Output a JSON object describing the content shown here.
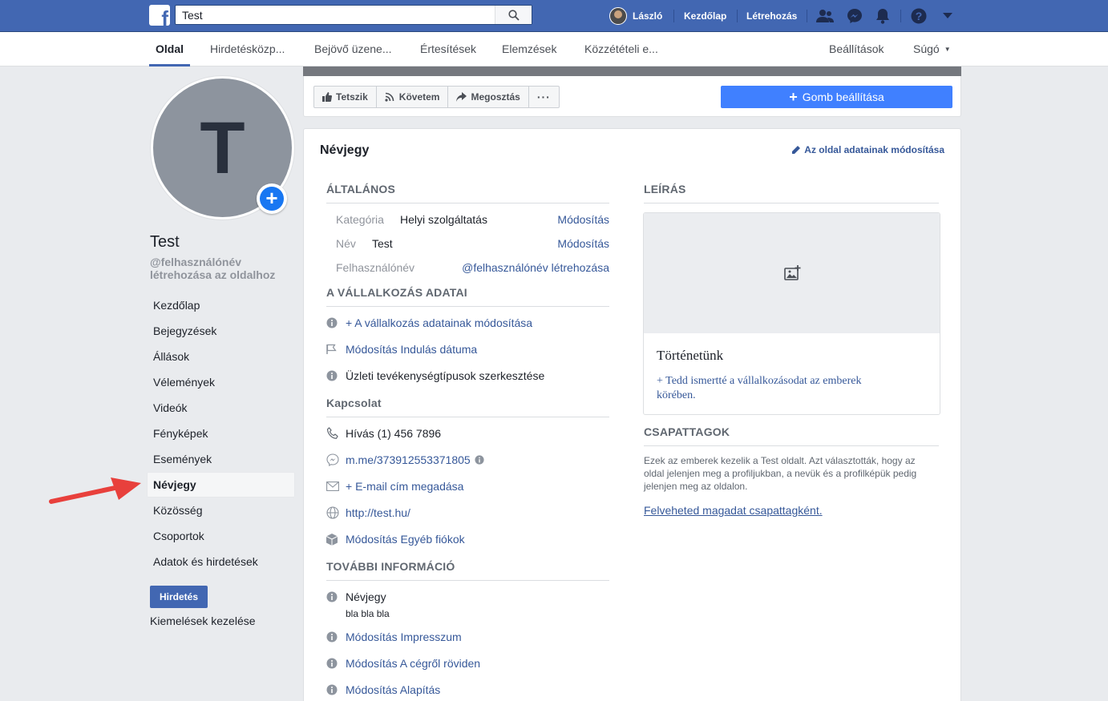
{
  "topbar": {
    "search_value": "Test",
    "user_name": "László",
    "home_label": "Kezdőlap",
    "create_label": "Létrehozás"
  },
  "subnav": {
    "tabs": [
      "Oldal",
      "Hirdetésközp...",
      "Bejövő üzene...",
      "Értesítések",
      "Elemzések",
      "Közzétételi e..."
    ],
    "settings": "Beállítások",
    "help": "Súgó"
  },
  "profile": {
    "letter": "T",
    "name": "Test",
    "handle": "@felhasználónév létrehozása az oldalhoz"
  },
  "leftnav": {
    "items": [
      "Kezdőlap",
      "Bejegyzések",
      "Állások",
      "Vélemények",
      "Videók",
      "Fényképek",
      "Események",
      "Névjegy",
      "Közösség",
      "Csoportok",
      "Adatok és hirdetések"
    ],
    "active_index": 7,
    "ad_button": "Hirdetés",
    "manage_highlights": "Kiemelések kezelése"
  },
  "actions": {
    "like": "Tetszik",
    "follow": "Követem",
    "share": "Megosztás",
    "more": "···",
    "cta": "Gomb beállítása"
  },
  "about": {
    "title": "Névjegy",
    "edit_page_info": "Az oldal adatainak módosítása",
    "general": {
      "heading": "ÁLTALÁNOS",
      "category_label": "Kategória",
      "category_value": "Helyi szolgáltatás",
      "name_label": "Név",
      "name_value": "Test",
      "username_label": "Felhasználónév",
      "username_value": "@felhasználónév létrehozása",
      "edit_label": "Módosítás"
    },
    "business": {
      "heading": "A VÁLLALKOZÁS ADATAI",
      "items": [
        "+ A vállalkozás adatainak módosítása",
        "Módosítás Indulás dátuma",
        "Üzleti tevékenységtípusok szerkesztése"
      ]
    },
    "contact": {
      "heading": "Kapcsolat",
      "phone": "Hívás (1) 456 7896",
      "messenger": "m.me/373912553371805",
      "email": "+ E-mail cím megadása",
      "website": "http://test.hu/",
      "other_accounts": "Módosítás Egyéb fiókok"
    },
    "more_info": {
      "heading": "TOVÁBBI INFORMÁCIÓ",
      "about_label": "Névjegy",
      "about_value": "bla bla bla",
      "impressum": "Módosítás Impresszum",
      "short_about": "Módosítás A cégről röviden",
      "founded": "Módosítás Alapítás"
    },
    "description": {
      "heading": "LEÍRÁS",
      "story_title": "Történetünk",
      "story_cta": "+ Tedd ismertté a vállalkozásodat az emberek körében."
    },
    "team": {
      "heading": "CSAPATTAGOK",
      "text": "Ezek az emberek kezelik a Test oldalt. Azt választották, hogy az oldal jelenjen meg a profiljukban, a nevük és a profilképük pedig jelenjen meg az oldalon.",
      "link": "Felveheted magadat csapattagként."
    }
  },
  "colors": {
    "brand": "#4267b2",
    "link": "#365899",
    "cta": "#4080ff",
    "background": "#e9ebee"
  }
}
